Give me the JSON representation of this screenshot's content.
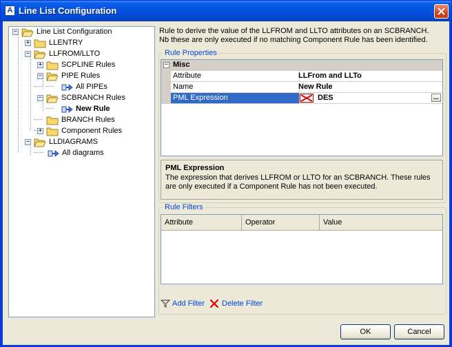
{
  "window": {
    "title": "Line List Configuration",
    "icon_letter": "A"
  },
  "tree": {
    "nodes": [
      {
        "label": "Line List Configuration",
        "expander": "−"
      },
      {
        "label": "LLENTRY",
        "expander": "+"
      },
      {
        "label": "LLFROM/LLTO",
        "expander": "−"
      },
      {
        "label": "SCPLINE Rules",
        "expander": "+"
      },
      {
        "label": "PIPE Rules",
        "expander": "−"
      },
      {
        "label": "All PIPEs"
      },
      {
        "label": "SCBRANCH Rules",
        "expander": "−"
      },
      {
        "label": "New Rule"
      },
      {
        "label": "BRANCH Rules"
      },
      {
        "label": "Component Rules",
        "expander": "+"
      },
      {
        "label": "LLDIAGRAMS",
        "expander": "−"
      },
      {
        "label": "All diagrams"
      }
    ]
  },
  "description": {
    "line1": "Rule to derive the value of the LLFROM and LLTO attributes on an SCBRANCH.",
    "line2": "Nb these are only executed if no matching Component Rule has been identified."
  },
  "rule_properties": {
    "group_label": "Rule Properties",
    "category": "Misc",
    "category_toggle": "−",
    "rows": [
      {
        "name": "Attribute",
        "value": "LLFrom and LLTo"
      },
      {
        "name": "Name",
        "value": "New Rule"
      },
      {
        "name": "PML Expression",
        "value": "DES",
        "button": "..."
      }
    ]
  },
  "help": {
    "title": "PML Expression",
    "line1": "The expression that derives LLFROM or LLTO for an SCBRANCH.  These rules",
    "line2": "are only executed if a Component Rule has not been executed."
  },
  "rule_filters": {
    "group_label": "Rule Filters",
    "columns": [
      "Attribute",
      "Operator",
      "Value"
    ]
  },
  "actions": {
    "add_filter": "Add Filter",
    "delete_filter": "Delete Filter"
  },
  "buttons": {
    "ok": "OK",
    "cancel": "Cancel"
  }
}
